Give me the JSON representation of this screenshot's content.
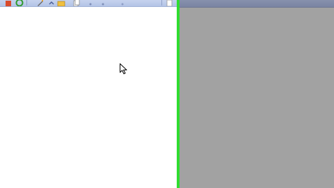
{
  "toolbar": {
    "buttons": [
      {
        "icon": "home-icon"
      },
      {
        "icon": "refresh-icon"
      },
      {
        "icon": "edit-icon"
      },
      {
        "icon": "folder-icon"
      },
      {
        "icon": "copy-icon"
      },
      {
        "icon": "star-icon"
      },
      {
        "icon": "page-icon"
      }
    ]
  },
  "colors": {
    "toolbar_bg": "#b3c3e6",
    "splitter": "#2fdc2f",
    "right_pane_bg": "#a2a2a2",
    "right_header": "#7a84a2"
  }
}
